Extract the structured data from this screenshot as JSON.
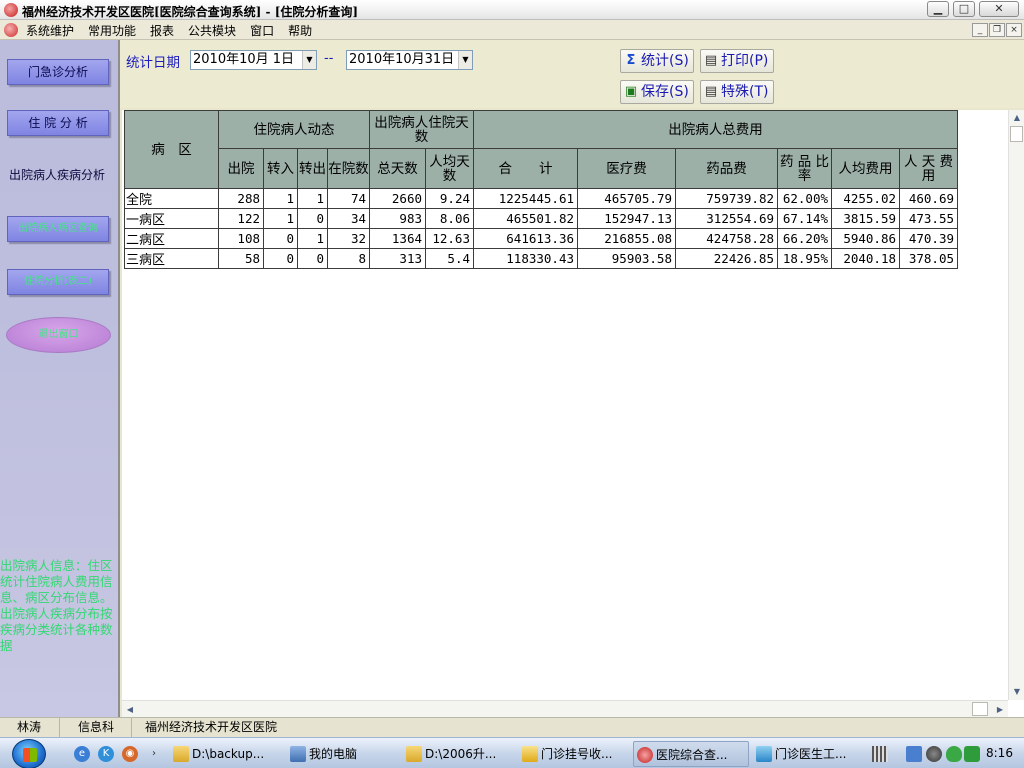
{
  "window": {
    "title": "福州经济技术开发区医院[医院综合查询系统] - [住院分析查询]",
    "min_glyph": "▁",
    "max_glyph": "□",
    "close_glyph": "✕",
    "mdi_min_glyph": "_",
    "mdi_restore_glyph": "❐",
    "mdi_close_glyph": "×"
  },
  "menu": {
    "items": [
      "系统维护",
      "常用功能",
      "报表",
      "公共模块",
      "窗口",
      "帮助"
    ]
  },
  "sidebar": {
    "buttons": [
      {
        "label": "门急诊分析"
      },
      {
        "label": "住 院 分 析"
      },
      {
        "label": "出院病人疾病分析"
      },
      {
        "label": "出院病人病区查询"
      },
      {
        "label": "住院分析(表二)"
      }
    ],
    "ellipse_label": "退出窗口",
    "description": "出院病人信息：住区统计住院病人费用信息、病区分布信息。出院病人疾病分布按疾病分类统计各种数据"
  },
  "toolbar": {
    "date_label": "统计日期",
    "start_date": "2010年10月 1日",
    "separator": "--",
    "end_date": "2010年10月31日",
    "dropdown_glyph": "▼",
    "stat_label": "统计(S)",
    "print_label": "打印(P)",
    "save_label": "保存(S)",
    "special_label": "特殊(T)",
    "icons": {
      "stat": "sigma-icon",
      "print": "printer-icon",
      "save": "floppy-disk-icon",
      "special": "printer-icon"
    }
  },
  "table": {
    "header_ward": "病　区",
    "group1": "住院病人动态",
    "group2": "出院病人住院天数",
    "group3": "出院病人总费用",
    "sub": [
      "出院",
      "转入",
      "转出",
      "在院数",
      "总天数",
      "人均天数",
      "合　　计",
      "医疗费",
      "药品费",
      "药 品 比 率",
      "人均费用",
      "人 天 费 用"
    ],
    "rows": [
      [
        "全院",
        "288",
        "1",
        "1",
        "74",
        "2660",
        "9.24",
        "1225445.61",
        "465705.79",
        "759739.82",
        "62.00%",
        "4255.02",
        "460.69"
      ],
      [
        "一病区",
        "122",
        "1",
        "0",
        "34",
        "983",
        "8.06",
        "465501.82",
        "152947.13",
        "312554.69",
        "67.14%",
        "3815.59",
        "473.55"
      ],
      [
        "二病区",
        "108",
        "0",
        "1",
        "32",
        "1364",
        "12.63",
        "641613.36",
        "216855.08",
        "424758.28",
        "66.20%",
        "5940.86",
        "470.39"
      ],
      [
        "三病区",
        "58",
        "0",
        "0",
        "8",
        "313",
        "5.4",
        "118330.43",
        "95903.58",
        "22426.85",
        "18.95%",
        "2040.18",
        "378.05"
      ]
    ]
  },
  "statusbar": {
    "user": "林涛",
    "department": "信息科",
    "hospital": "福州经济技术开发区医院"
  },
  "taskbar": {
    "items": [
      {
        "label": "D:\\backup...",
        "icon": "folder-icon"
      },
      {
        "label": "我的电脑",
        "icon": "computer-icon"
      },
      {
        "label": "D:\\2006升...",
        "icon": "folder-icon"
      },
      {
        "label": "门诊挂号收...",
        "icon": "app-icon"
      },
      {
        "label": "医院综合查...",
        "icon": "app-icon"
      },
      {
        "label": "门诊医生工...",
        "icon": "app-icon"
      }
    ],
    "clock": "8:16"
  },
  "colors": {
    "accent_blue": "#1d1dbd",
    "header_bg": "#9db0a8",
    "sidebar_text_green": "#32d872"
  }
}
